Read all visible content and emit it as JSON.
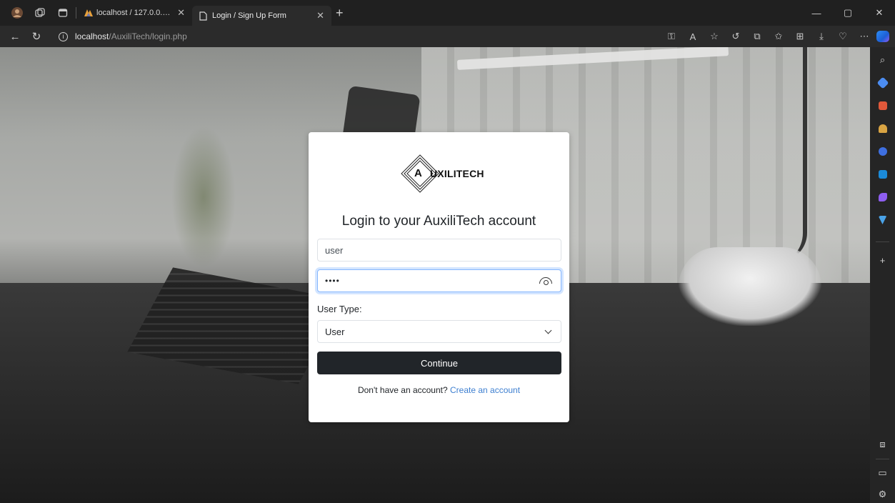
{
  "browser": {
    "tabs": [
      {
        "title": "localhost / 127.0.0.1 / auxilitech /",
        "active": false
      },
      {
        "title": "Login / Sign Up Form",
        "active": true
      }
    ],
    "new_tab_label": "+",
    "url_host": "localhost",
    "url_path": "/AuxiliTech/login.php"
  },
  "logo": {
    "letter": "A",
    "text": "UXILITECH"
  },
  "login": {
    "heading": "Login to your AuxiliTech account",
    "username_value": "user",
    "password_masked": "••••",
    "user_type_label": "User Type:",
    "user_type_selected": "User",
    "continue_label": "Continue",
    "signup_prompt": "Don't have an account?",
    "signup_link": "Create an account"
  },
  "colors": {
    "button_bg": "#212529",
    "link": "#3d7fd0",
    "focus_border": "#86b7fe"
  }
}
